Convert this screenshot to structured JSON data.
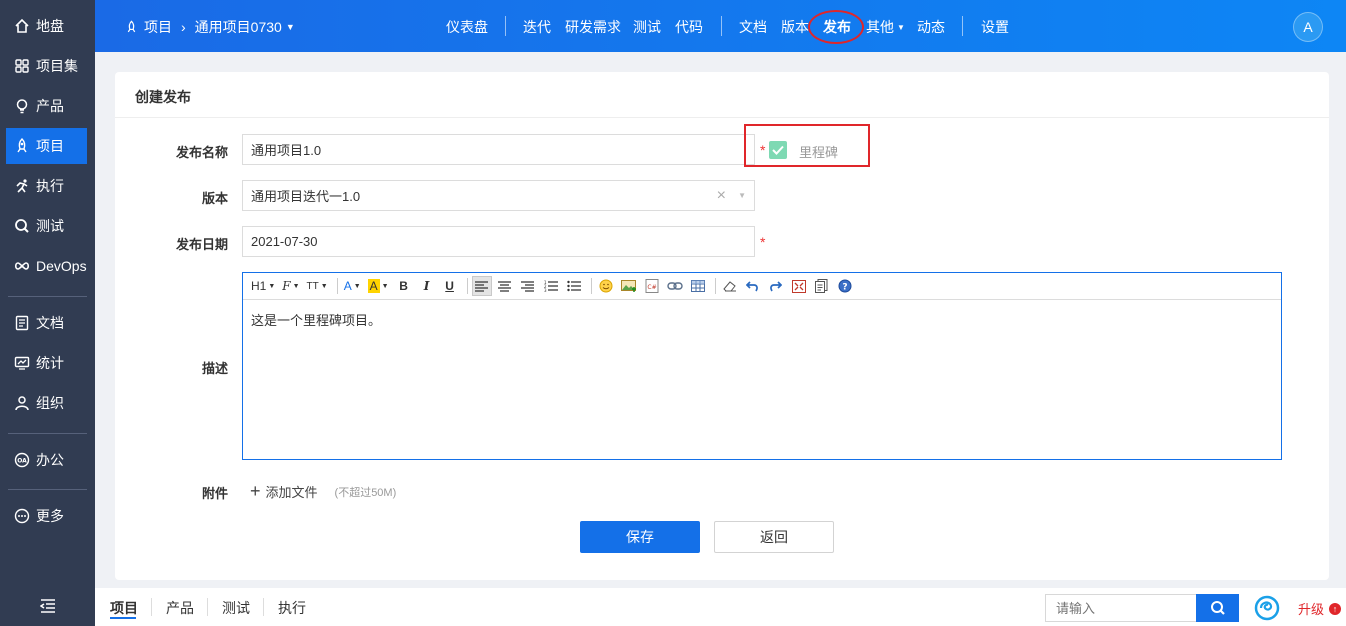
{
  "sidebar": {
    "items": [
      {
        "label": "地盘",
        "icon": "home-icon"
      },
      {
        "label": "项目集",
        "icon": "grid-icon"
      },
      {
        "label": "产品",
        "icon": "bulb-icon"
      },
      {
        "label": "项目",
        "icon": "rocket-icon"
      },
      {
        "label": "执行",
        "icon": "run-icon"
      },
      {
        "label": "测试",
        "icon": "search-icon"
      },
      {
        "label": "DevOps",
        "icon": "infinity-icon"
      },
      {
        "label": "文档",
        "icon": "doc-icon"
      },
      {
        "label": "统计",
        "icon": "monitor-icon"
      },
      {
        "label": "组织",
        "icon": "user-icon"
      },
      {
        "label": "办公",
        "icon": "oa-icon"
      },
      {
        "label": "更多",
        "icon": "more-icon"
      }
    ],
    "active_index": 3
  },
  "topbar": {
    "section": "项目",
    "project": "通用项目0730",
    "nav": [
      "仪表盘",
      "迭代",
      "研发需求",
      "测试",
      "代码",
      "文档",
      "版本",
      "发布",
      "其他",
      "动态",
      "设置"
    ],
    "active_nav": "发布",
    "avatar": "A"
  },
  "form": {
    "title": "创建发布",
    "name_label": "发布名称",
    "name_value": "通用项目1.0",
    "milestone_label": "里程碑",
    "milestone_checked": true,
    "build_label": "版本",
    "build_value": "通用项目迭代一1.0",
    "date_label": "发布日期",
    "date_value": "2021-07-30",
    "desc_label": "描述",
    "desc_value": "这是一个里程碑项目。",
    "attach_label": "附件",
    "add_file": "添加文件",
    "file_limit": "(不超过50M)",
    "save": "保存",
    "back": "返回",
    "required_mark": "*"
  },
  "editor_toolbar": {
    "heading": "H1",
    "font_family": "F",
    "font_size": "TT",
    "font_color": "A",
    "bg_color": "A",
    "bold": "B",
    "italic": "I",
    "underline": "U"
  },
  "bottombar": {
    "tabs": [
      "项目",
      "产品",
      "测试",
      "执行"
    ],
    "active_tab": "项目",
    "search_placeholder": "请输入",
    "upgrade": "升级"
  },
  "colors": {
    "primary": "#1470e8",
    "sidebar": "#313c52",
    "highlight_red": "#e0262a",
    "checkbox_green": "#7ed9b3"
  }
}
